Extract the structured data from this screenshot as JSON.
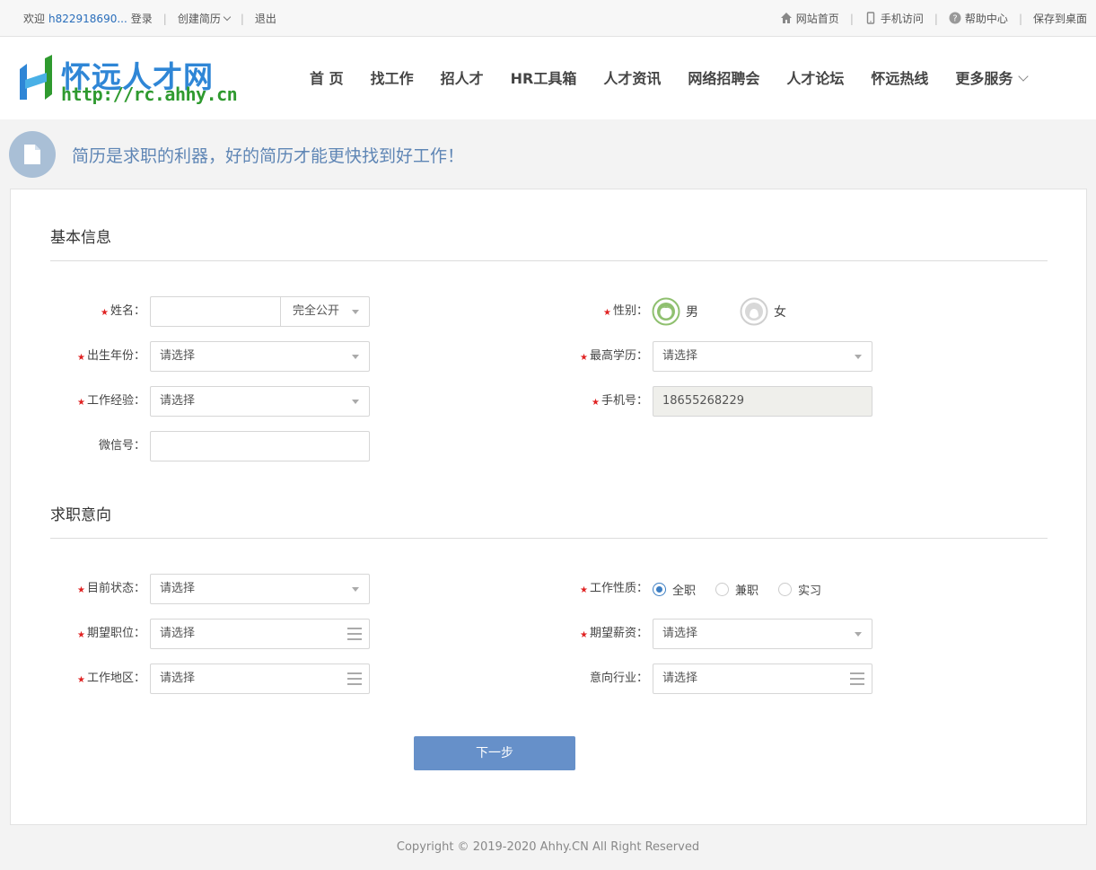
{
  "topbar": {
    "welcome": "欢迎",
    "username": "h822918690...",
    "login": "登录",
    "create_resume": "创建简历",
    "logout": "退出",
    "site_home": "网站首页",
    "mobile": "手机访问",
    "help": "帮助中心",
    "save_desktop": "保存到桌面"
  },
  "logo": {
    "name": "怀远人才网",
    "url": "http://rc.ahhy.cn"
  },
  "nav": [
    "首 页",
    "找工作",
    "招人才",
    "HR工具箱",
    "人才资讯",
    "网络招聘会",
    "人才论坛",
    "怀远热线"
  ],
  "nav_more": "更多服务",
  "banner": {
    "text": "简历是求职的利器，好的简历才能更快找到好工作！"
  },
  "basic": {
    "title": "基本信息",
    "name_label": "姓名：",
    "name_value": "",
    "privacy_value": "完全公开",
    "gender_label": "性别：",
    "gender_male": "男",
    "gender_female": "女",
    "birth_label": "出生年份：",
    "birth_value": "请选择",
    "edu_label": "最高学历：",
    "edu_value": "请选择",
    "exp_label": "工作经验：",
    "exp_value": "请选择",
    "phone_label": "手机号：",
    "phone_value": "18655268229",
    "wechat_label": "微信号：",
    "wechat_value": ""
  },
  "intent": {
    "title": "求职意向",
    "status_label": "目前状态：",
    "status_value": "请选择",
    "nature_label": "工作性质：",
    "nature_options": [
      "全职",
      "兼职",
      "实习"
    ],
    "nature_selected": 0,
    "position_label": "期望职位：",
    "position_value": "请选择",
    "salary_label": "期望薪资：",
    "salary_value": "请选择",
    "area_label": "工作地区：",
    "area_value": "请选择",
    "industry_label": "意向行业：",
    "industry_value": "请选择"
  },
  "next_button": "下一步",
  "footer": "Copyright © 2019-2020 Ahhy.CN All Right Reserved",
  "colors": {
    "accent": "#6690c9",
    "brand_blue": "#2f86d6",
    "brand_green": "#2f9a2f",
    "required": "#e02222"
  }
}
